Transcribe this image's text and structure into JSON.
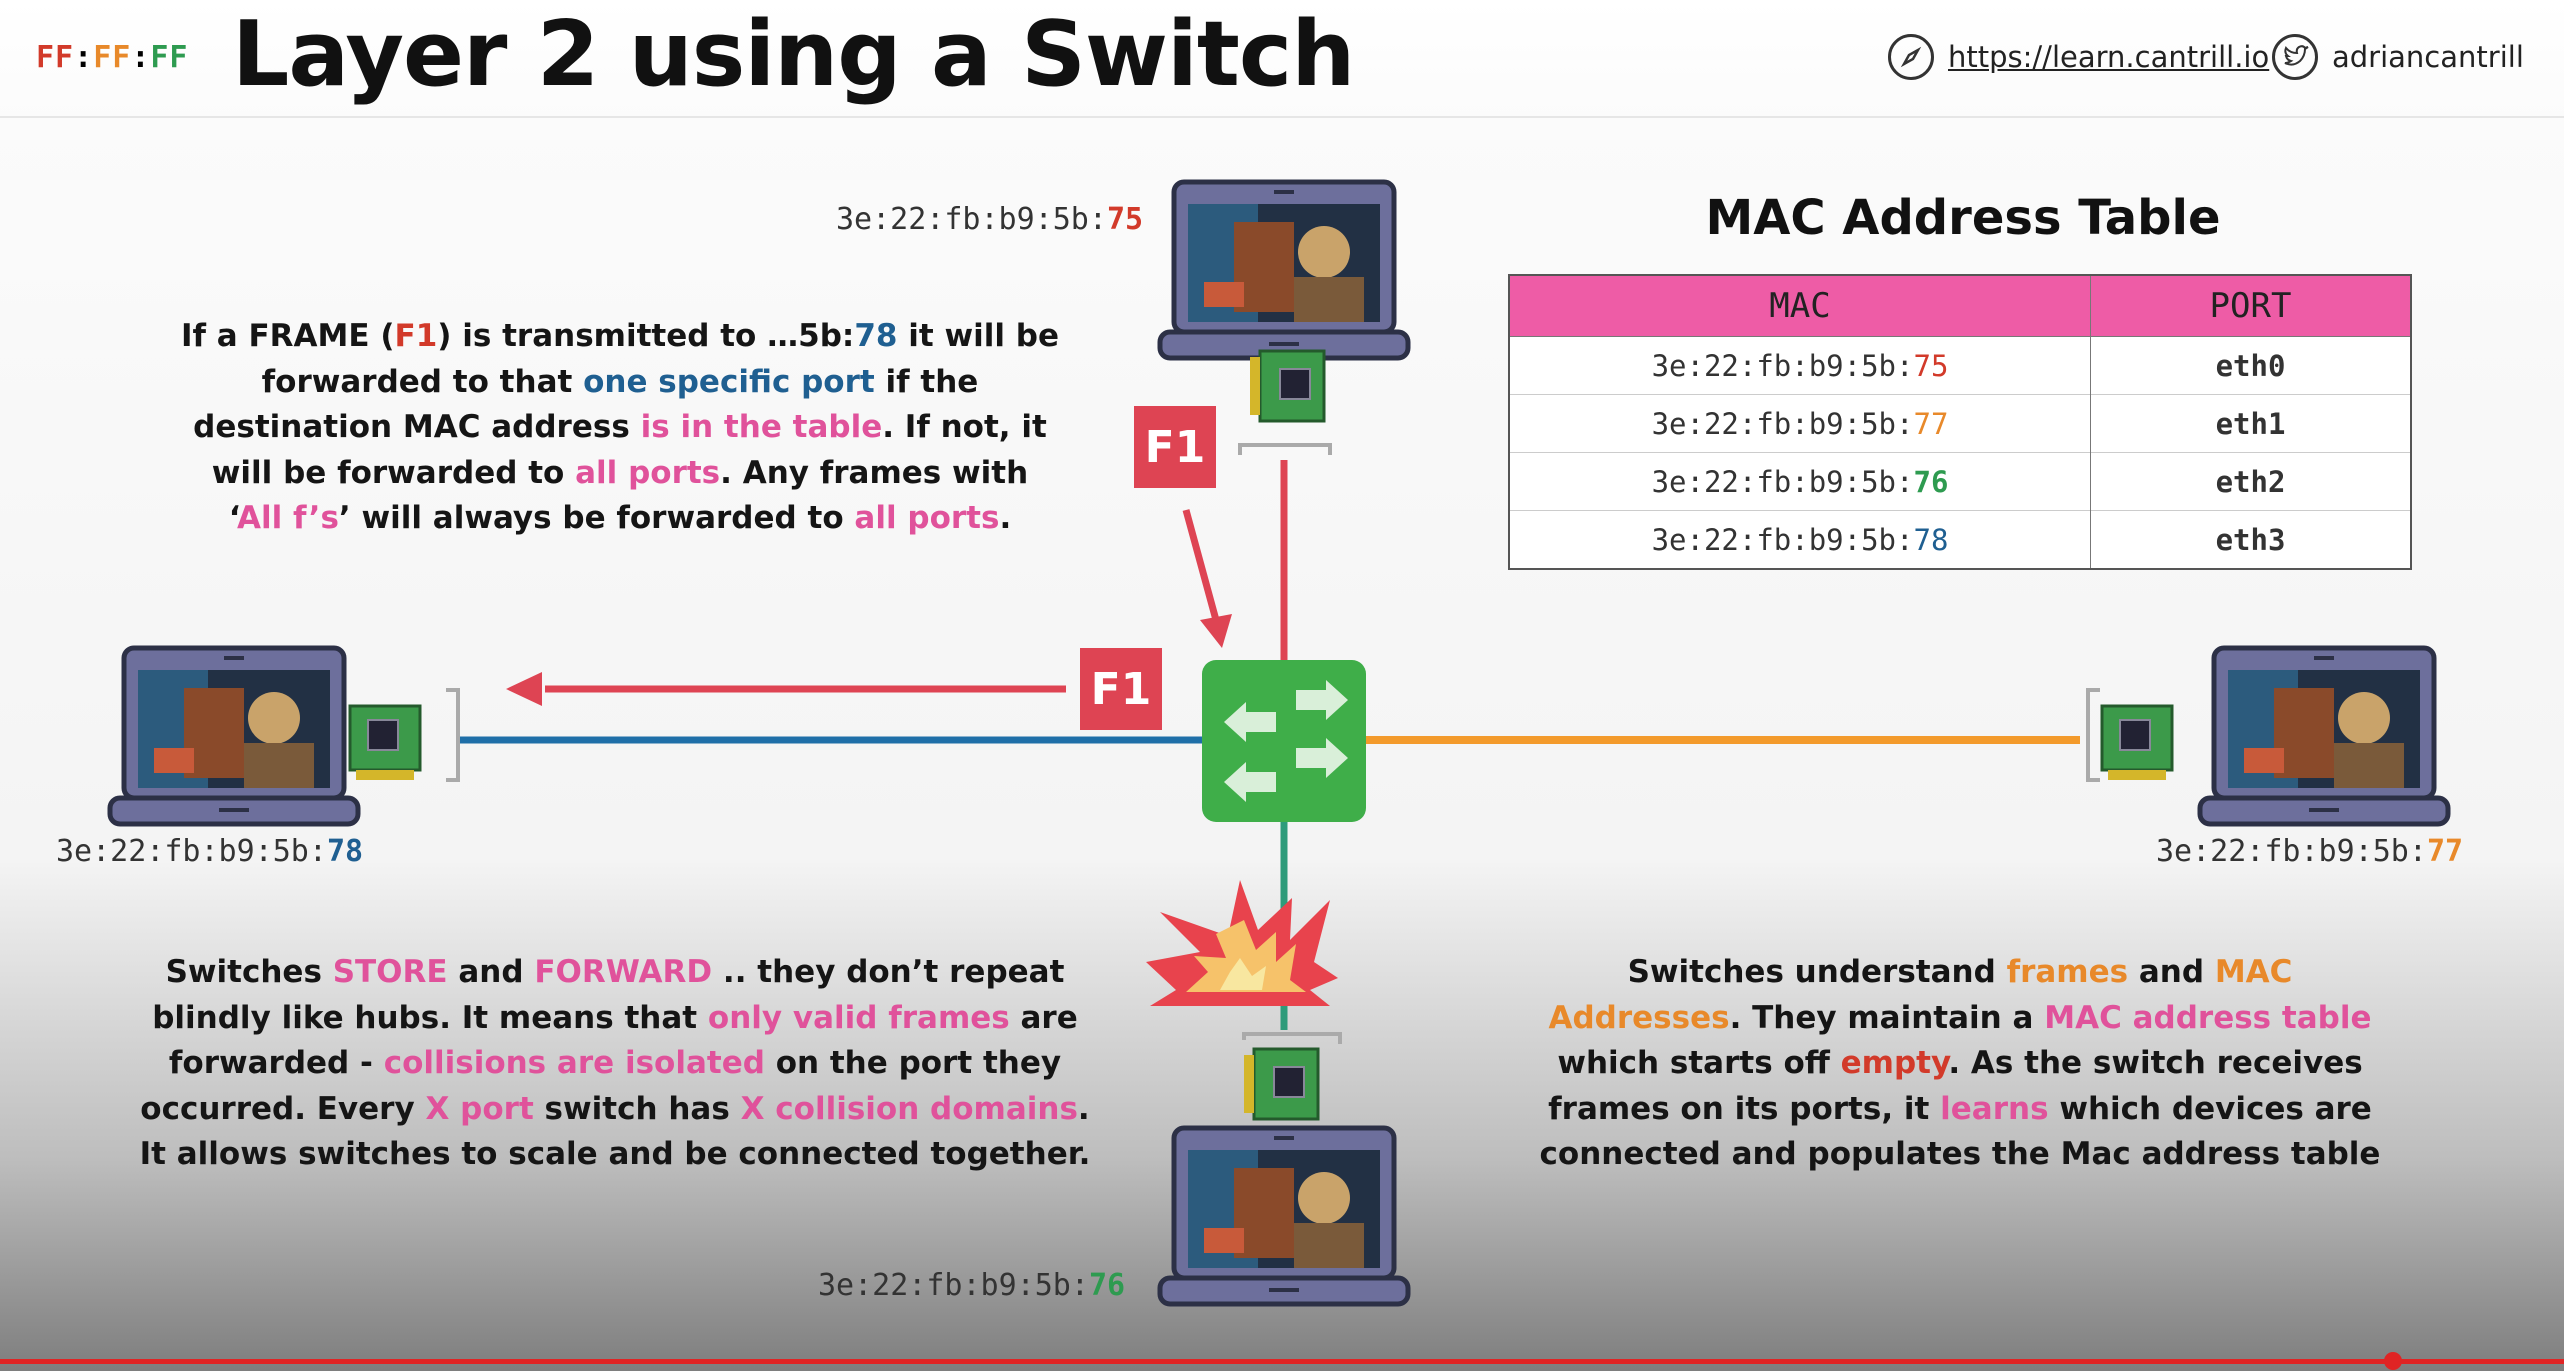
{
  "header": {
    "logo": {
      "part1": "FF",
      "sep1": ":",
      "part2": "FF",
      "sep2": ":",
      "part3": "FF"
    },
    "title": "Layer 2 using a Switch",
    "website": "https://learn.cantrill.io",
    "twitter": "adriancantrill",
    "colors": {
      "logo1": "#d23a2a",
      "logo2": "#e8892a",
      "logo3": "#2e9b50"
    }
  },
  "devices": {
    "top": {
      "mac_prefix": "3e:22:fb:b9:5b:",
      "mac_suffix": "75"
    },
    "left": {
      "mac_prefix": "3e:22:fb:b9:5b:",
      "mac_suffix": "78"
    },
    "right": {
      "mac_prefix": "3e:22:fb:b9:5b:",
      "mac_suffix": "77"
    },
    "bottom": {
      "mac_prefix": "3e:22:fb:b9:5b:",
      "mac_suffix": "76"
    }
  },
  "frames": {
    "f1_top": "F1",
    "f1_left": "F1"
  },
  "mac_table": {
    "title": "MAC Address Table",
    "headers": {
      "mac": "MAC",
      "port": "PORT"
    },
    "rows": [
      {
        "mac_prefix": "3e:22:fb:b9:5b:",
        "mac_suffix": "75",
        "port": "eth0"
      },
      {
        "mac_prefix": "3e:22:fb:b9:5b:",
        "mac_suffix": "77",
        "port": "eth1"
      },
      {
        "mac_prefix": "3e:22:fb:b9:5b:",
        "mac_suffix": "76",
        "port": "eth2"
      },
      {
        "mac_prefix": "3e:22:fb:b9:5b:",
        "mac_suffix": "78",
        "port": "eth3"
      }
    ]
  },
  "text_top_left": {
    "l1a": "If a FRAME (",
    "l1b": "F1",
    "l1c": ") is transmitted to …5b:",
    "l1d": "78",
    "l1e": " it will be",
    "l2a": "forwarded to that ",
    "l2b": "one specific port",
    "l2c": " if the",
    "l3a": "destination MAC address ",
    "l3b": "is in the table",
    "l3c": ". If not, it",
    "l4a": "will be forwarded to ",
    "l4b": "all ports",
    "l4c": ". Any frames with",
    "l5a": "‘",
    "l5b": "All f’s",
    "l5c": "’ will always be forwarded to ",
    "l5d": "all ports",
    "l5e": "."
  },
  "text_bottom_left": {
    "l1a": "Switches ",
    "l1b": "STORE",
    "l1c": " and ",
    "l1d": "FORWARD",
    "l1e": " .. they don’t repeat",
    "l2a": "blindly like hubs. It means that ",
    "l2b": "only valid frames",
    "l2c": " are",
    "l3a": "forwarded - ",
    "l3b": "collisions are isolated",
    "l3c": " on the port they",
    "l4a": "occurred. Every ",
    "l4b": "X port",
    "l4c": " switch has ",
    "l4d": "X collision domains",
    "l4e": ".",
    "l5": "It allows switches to scale and be connected together."
  },
  "text_bottom_right": {
    "l1a": "Switches understand ",
    "l1b": "frames",
    "l1c": " and ",
    "l1d": "MAC",
    "l2a": "Addresses",
    "l2b": ". They maintain a ",
    "l2c": "MAC address table",
    "l3a": "which starts off ",
    "l3b": "empty",
    "l3c": ". As the switch receives",
    "l4a": "frames on its ports, it ",
    "l4b": "learns",
    "l4c": " which devices are",
    "l5": "connected and populates the Mac address table"
  },
  "colors": {
    "link_top": "#de4453",
    "link_left": "#1f6fa8",
    "link_right": "#f39a2b",
    "link_bottom": "#2e9b7a",
    "switch": "#3fae49",
    "frame": "#de4453",
    "table_header": "#ee5ca6"
  }
}
